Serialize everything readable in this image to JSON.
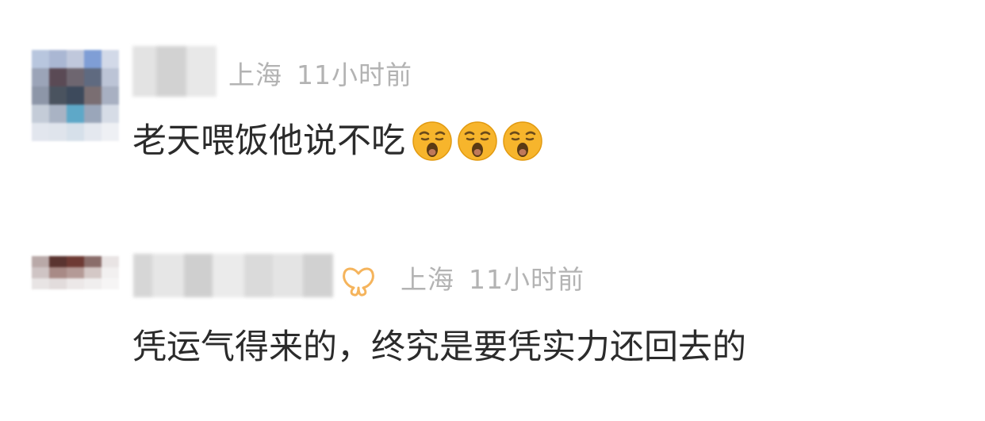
{
  "comments": [
    {
      "avatar_icon": "pixelated-avatar",
      "username_icon": "blurred-username",
      "location": "上海",
      "time": "11小时前",
      "text": "老天喂饭他说不吃",
      "emojis": [
        "yawn-emoji",
        "yawn-emoji",
        "yawn-emoji"
      ]
    },
    {
      "avatar_icon": "pixelated-avatar",
      "username_icon": "blurred-username",
      "badge_icon": "vip-butterfly-icon",
      "location": "上海",
      "time": "11小时前",
      "text": "凭运气得来的，终究是要凭实力还回去的"
    }
  ],
  "colors": {
    "meta_text": "#b3b3b3",
    "body_text": "#2b2b2b",
    "badge": "#f5b45c",
    "emoji_face": "#f7b52c"
  }
}
